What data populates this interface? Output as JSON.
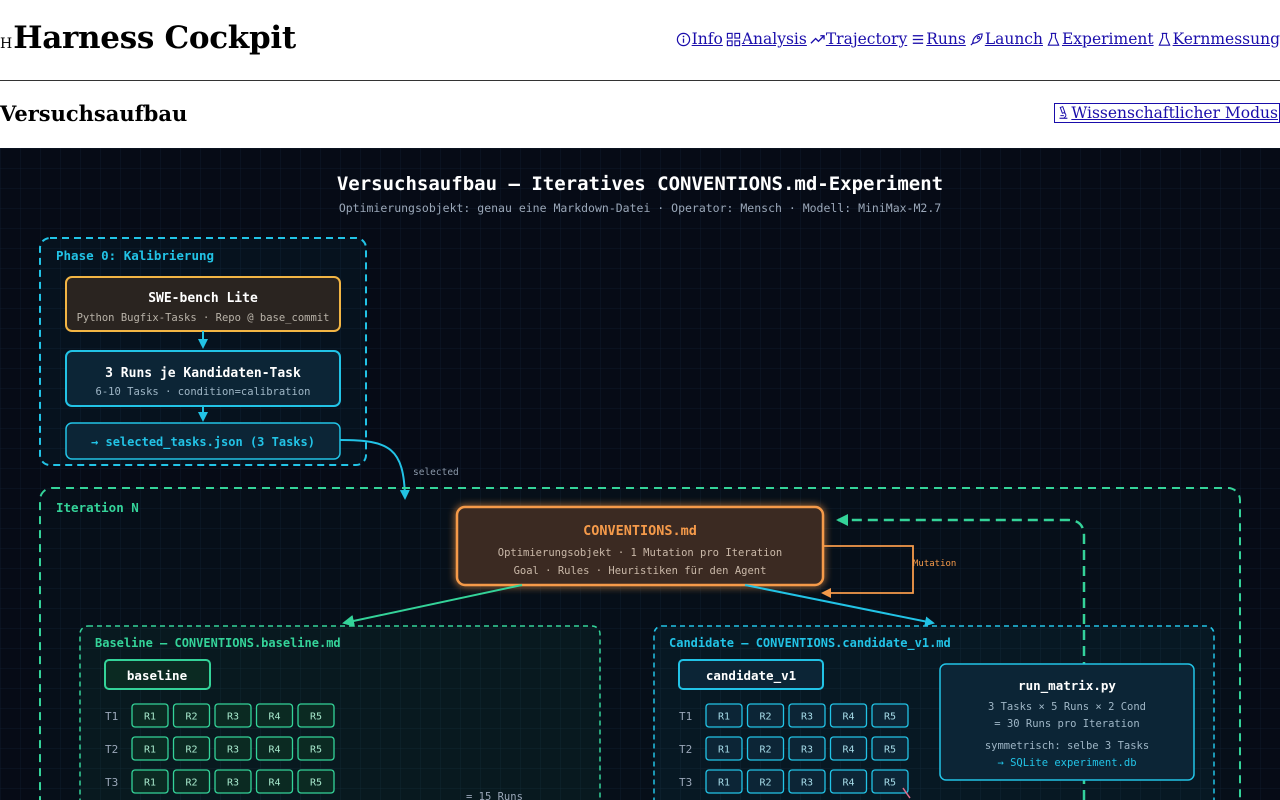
{
  "header": {
    "brand_mark": "H",
    "title": "Harness Cockpit",
    "nav": [
      {
        "label": "Info",
        "icon": "info-icon"
      },
      {
        "label": "Analysis",
        "icon": "grid-icon"
      },
      {
        "label": "Trajectory",
        "icon": "trend-icon"
      },
      {
        "label": "Runs",
        "icon": "list-icon"
      },
      {
        "label": "Launch",
        "icon": "rocket-icon"
      },
      {
        "label": "Experiment",
        "icon": "flask-icon"
      },
      {
        "label": "Kernmessung",
        "icon": "flask-icon"
      }
    ]
  },
  "page": {
    "title": "Versuchsaufbau",
    "mode_button": "Wissenschaftlicher Modus",
    "mode_icon": "microscope-icon"
  },
  "diagram": {
    "title": "Versuchsaufbau — Iteratives CONVENTIONS.md-Experiment",
    "subtitle": "Optimierungsobjekt: genau eine Markdown-Datei · Operator: Mensch · Modell: MiniMax-M2.7",
    "phase0": {
      "label": "Phase 0: Kalibrierung",
      "bench_title": "SWE-bench Lite",
      "bench_sub": "Python Bugfix-Tasks · Repo @ base_commit",
      "runs_title": "3 Runs je Kandidaten-Task",
      "runs_sub": "6-10 Tasks · condition=calibration",
      "selected": "→ selected_tasks.json (3 Tasks)",
      "edge_label": "selected"
    },
    "iteration": {
      "label": "Iteration N",
      "conv_title": "CONVENTIONS.md",
      "conv_line1": "Optimierungsobjekt · 1 Mutation pro Iteration",
      "conv_line2": "Goal · Rules · Heuristiken für den Agent",
      "mutation_label": "Mutation"
    },
    "baseline": {
      "label": "Baseline — CONVENTIONS.baseline.md",
      "tag": "baseline",
      "tasks": [
        "T1",
        "T2",
        "T3"
      ],
      "runs": [
        "R1",
        "R2",
        "R3",
        "R4",
        "R5"
      ],
      "total": "= 15 Runs"
    },
    "candidate": {
      "label": "Candidate — CONVENTIONS.candidate_v1.md",
      "tag": "candidate_v1",
      "tasks": [
        "T1",
        "T2",
        "T3"
      ],
      "runs": [
        "R1",
        "R2",
        "R3",
        "R4",
        "R5"
      ]
    },
    "matrix": {
      "title": "run_matrix.py",
      "line1": "3 Tasks × 5 Runs × 2 Cond",
      "line2": "= 30 Runs pro Iteration",
      "line3": "symmetrisch: selbe 3 Tasks",
      "line4": "→ SQLite experiment.db"
    },
    "colors": {
      "background": "#060b16",
      "cyan": "#22c3e6",
      "green": "#34d399",
      "orange": "#f59a4a",
      "amber": "#f2b544"
    }
  }
}
